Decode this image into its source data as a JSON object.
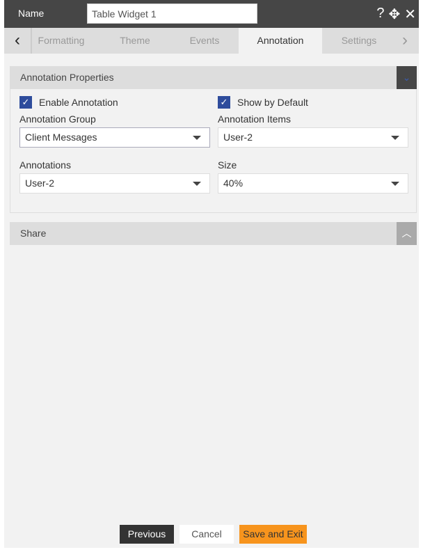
{
  "header": {
    "name_label": "Name",
    "name_value": "Table Widget 1",
    "icons": [
      "help-icon",
      "move-icon",
      "close-icon"
    ]
  },
  "tabs": [
    {
      "label": "Formatting"
    },
    {
      "label": "Theme"
    },
    {
      "label": "Events"
    },
    {
      "label": "Annotation",
      "active": true
    },
    {
      "label": "Settings"
    }
  ],
  "annotation": {
    "title": "Annotation Properties",
    "enable_label": "Enable Annotation",
    "enable_checked": true,
    "show_label": "Show by Default",
    "show_checked": true,
    "group_label": "Annotation Group",
    "group_value": "Client Messages",
    "items_label": "Annotation Items",
    "items_value": "User-2",
    "annotations_label": "Annotations",
    "annotations_value": "User-2",
    "size_label": "Size",
    "size_value": "40%"
  },
  "share": {
    "title": "Share"
  },
  "footer": {
    "previous": "Previous",
    "cancel": "Cancel",
    "save": "Save and Exit"
  },
  "colors": {
    "header": "#464646",
    "checkbox": "#2e4c9c",
    "save": "#f7941d"
  }
}
